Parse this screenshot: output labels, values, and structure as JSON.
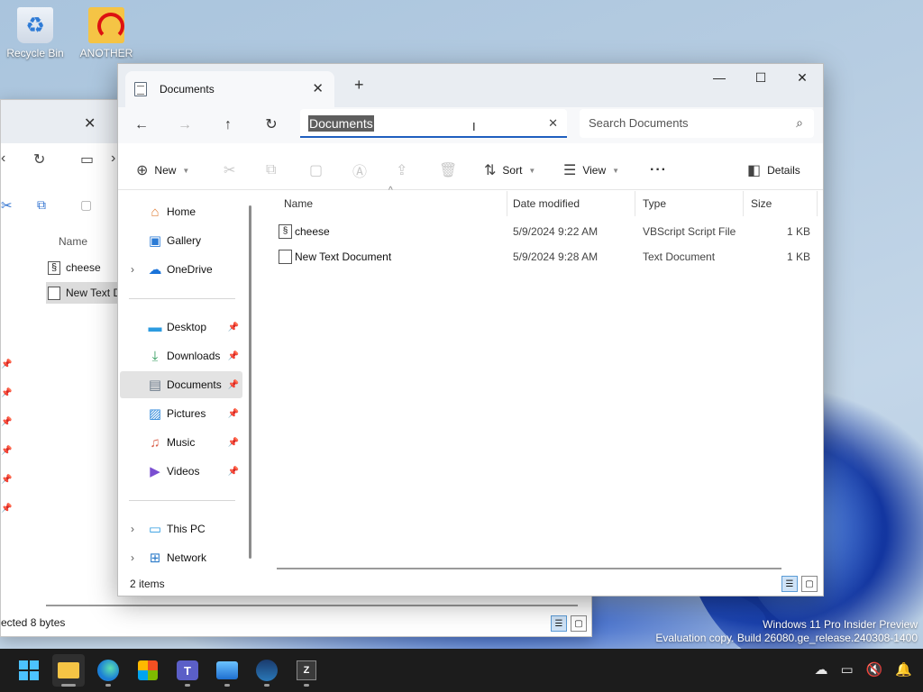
{
  "desktop": {
    "icons": [
      {
        "label": "Recycle Bin"
      },
      {
        "label": "ANOTHER"
      }
    ],
    "watermark": {
      "line1": "Windows 11 Pro Insider Preview",
      "line2": "Evaluation copy. Build 26080.ge_release.240308-1400"
    }
  },
  "back_window": {
    "column_name": "Name",
    "files": [
      "cheese",
      "New Text D"
    ],
    "status": "ected  8 bytes"
  },
  "window": {
    "tab_title": "Documents",
    "new_tab_symbol": "+",
    "controls": {
      "minimize": "—",
      "maximize": "☐",
      "close": "✕"
    },
    "address_value": "Documents",
    "search_placeholder": "Search Documents",
    "commands": {
      "new": "New",
      "sort": "Sort",
      "view": "View",
      "details": "Details"
    },
    "nav": {
      "home": "Home",
      "gallery": "Gallery",
      "onedrive": "OneDrive",
      "desktop": "Desktop",
      "downloads": "Downloads",
      "documents": "Documents",
      "pictures": "Pictures",
      "music": "Music",
      "videos": "Videos",
      "thispc": "This PC",
      "network": "Network"
    },
    "columns": {
      "name": "Name",
      "date": "Date modified",
      "type": "Type",
      "size": "Size"
    },
    "files": [
      {
        "name": "cheese",
        "date": "5/9/2024 9:22 AM",
        "type": "VBScript Script File",
        "size": "1 KB",
        "icon": "vbscript-file-icon"
      },
      {
        "name": "New Text Document",
        "date": "5/9/2024 9:28 AM",
        "type": "Text Document",
        "size": "1 KB",
        "icon": "text-file-icon"
      }
    ],
    "status_count": "2 items"
  },
  "colors": {
    "accent": "#1f5fbf",
    "selection": "#5e5e5e",
    "taskbar": "#1c1c1c"
  }
}
